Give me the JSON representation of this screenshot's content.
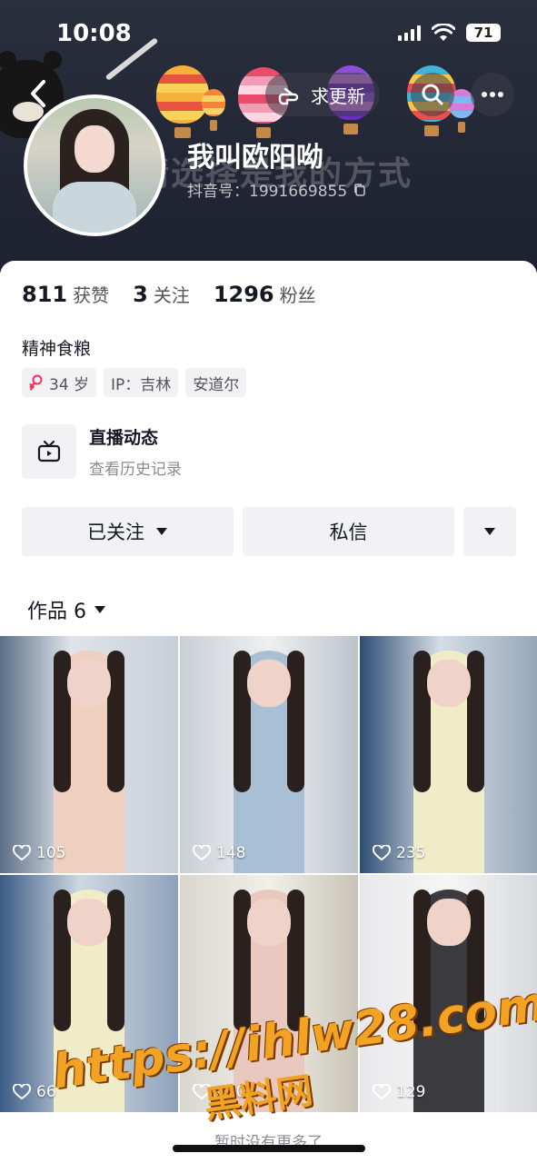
{
  "status_bar": {
    "time": "10:08",
    "battery": "71"
  },
  "header": {
    "banner_slogan": "精选择是我的方式",
    "request_update_label": "求更新",
    "nickname": "我叫欧阳呦",
    "douyin_id": "抖音号：1991669855"
  },
  "stats": {
    "likes_value": "811",
    "likes_label": "获赞",
    "following_value": "3",
    "following_label": "关注",
    "followers_value": "1296",
    "followers_label": "粉丝"
  },
  "bio": "精神食粮",
  "tags": {
    "age": "34 岁",
    "ip": "IP：吉林",
    "location": "安道尔"
  },
  "live": {
    "title": "直播动态",
    "subtitle": "查看历史记录"
  },
  "actions": {
    "follow_label": "已关注",
    "message_label": "私信"
  },
  "works": {
    "label": "作品 6"
  },
  "videos": [
    {
      "likes": "105"
    },
    {
      "likes": "148"
    },
    {
      "likes": "235"
    },
    {
      "likes": "66"
    },
    {
      "likes": "120"
    },
    {
      "likes": "129"
    }
  ],
  "end_text": "暂时没有更多了",
  "watermark": {
    "url": "https://ihlw28.com",
    "name": "黑料网"
  },
  "colors": {
    "accent_pink": "#fe2c55",
    "watermark_orange": "#f2a323"
  }
}
